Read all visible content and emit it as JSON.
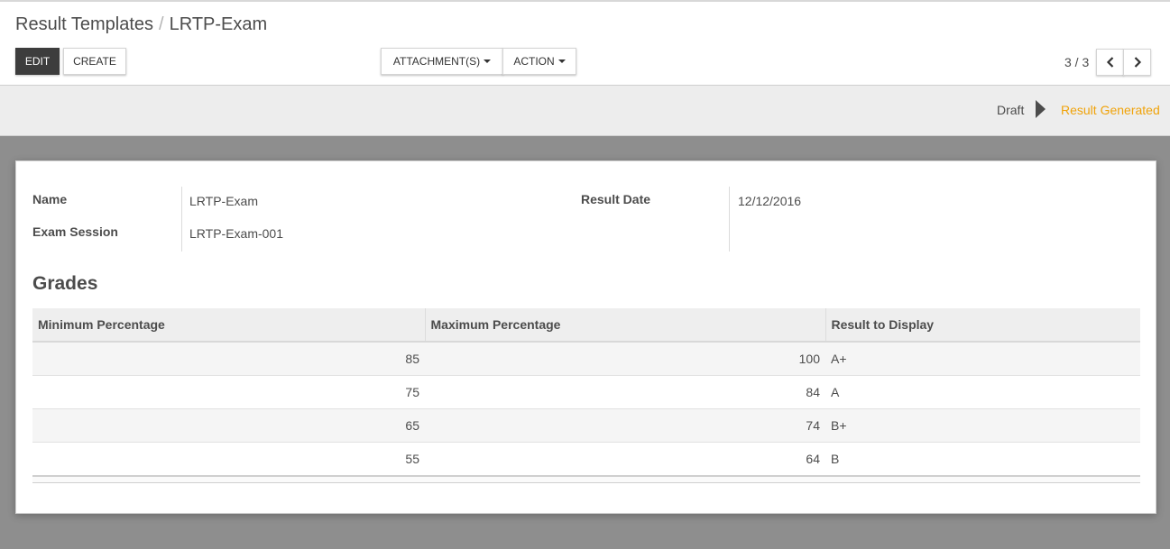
{
  "breadcrumb": {
    "parent": "Result Templates",
    "separator": "/",
    "current": "LRTP-Exam"
  },
  "toolbar": {
    "edit_label": "EDIT",
    "create_label": "CREATE",
    "attachments_label": "ATTACHMENT(S)",
    "action_label": "ACTION"
  },
  "pager": {
    "value": "3 / 3"
  },
  "statusbar": {
    "states": [
      "Draft",
      "Result Generated"
    ],
    "current": "Result Generated",
    "current_color": "#f0a30a"
  },
  "form": {
    "name_label": "Name",
    "name_value": "LRTP-Exam",
    "exam_session_label": "Exam Session",
    "exam_session_value": "LRTP-Exam-001",
    "result_date_label": "Result Date",
    "result_date_value": "12/12/2016"
  },
  "grades": {
    "title": "Grades",
    "columns": [
      "Minimum Percentage",
      "Maximum Percentage",
      "Result to Display"
    ],
    "rows": [
      {
        "min": "85",
        "max": "100",
        "result": "A+"
      },
      {
        "min": "75",
        "max": "84",
        "result": "A"
      },
      {
        "min": "65",
        "max": "74",
        "result": "B+"
      },
      {
        "min": "55",
        "max": "64",
        "result": "B"
      }
    ]
  }
}
